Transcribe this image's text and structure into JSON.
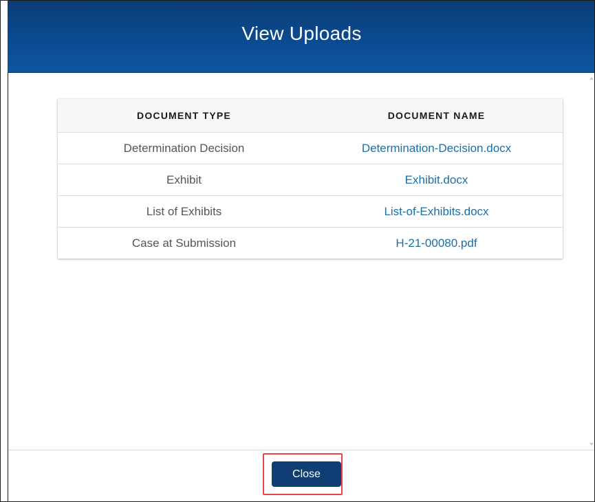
{
  "modal": {
    "title": "View Uploads"
  },
  "table": {
    "columns": [
      "DOCUMENT TYPE",
      "DOCUMENT NAME"
    ],
    "rows": [
      {
        "type": "Determination Decision",
        "name": "Determination-Decision.docx"
      },
      {
        "type": "Exhibit",
        "name": "Exhibit.docx"
      },
      {
        "type": "List of Exhibits",
        "name": "List-of-Exhibits.docx"
      },
      {
        "type": "Case at Submission",
        "name": "H-21-00080.pdf"
      }
    ]
  },
  "footer": {
    "close_label": "Close"
  },
  "colors": {
    "header_bg": "#0b4a8f",
    "link": "#1c6ea4",
    "button_bg": "#0f3e74",
    "highlight": "#e8474a"
  }
}
